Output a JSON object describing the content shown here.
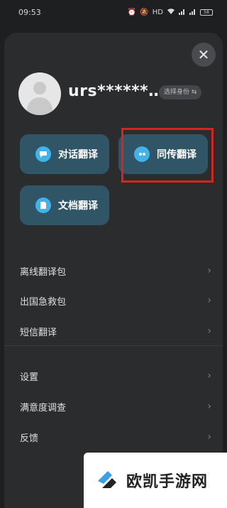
{
  "status_bar": {
    "time": "09:53",
    "icons": [
      "alarm-icon",
      "mute-icon",
      "hd-icon",
      "wifi-icon",
      "signal-icon",
      "signal-icon",
      "battery-icon"
    ],
    "battery_level": "58"
  },
  "panel": {
    "close_glyph": "✕",
    "user": {
      "name": "urs******…",
      "identity_chip": "选择身份 ⇆"
    },
    "features": [
      {
        "label": "对话翻译",
        "icon": "chat-bubble-icon"
      },
      {
        "label": "同传翻译",
        "icon": "simultaneous-icon"
      },
      {
        "label": "文档翻译",
        "icon": "document-icon"
      }
    ],
    "menu_group_1": [
      {
        "label": "离线翻译包"
      },
      {
        "label": "出国急救包"
      },
      {
        "label": "短信翻译"
      }
    ],
    "menu_group_2": [
      {
        "label": "设置"
      },
      {
        "label": "满意度调查"
      },
      {
        "label": "反馈"
      }
    ],
    "chevron": "›"
  },
  "watermark": {
    "text": "欧凯手游网"
  },
  "colors": {
    "background": "#1e1f21",
    "panel": "#2b2c2e",
    "feature_button": "#305567",
    "feature_icon": "#42b3e8",
    "highlight": "#d6241f"
  }
}
